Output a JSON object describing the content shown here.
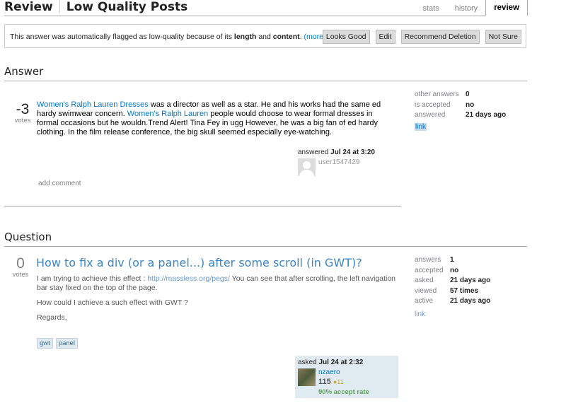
{
  "header": {
    "title": "Review",
    "subtitle": "Low Quality Posts",
    "tabs": [
      "stats",
      "history",
      "review"
    ]
  },
  "notice": {
    "text_pre": "This answer was automatically flagged as low-quality because of its ",
    "bold1": "length",
    "text_mid": " and ",
    "bold2": "content",
    "text_post": ". ",
    "more": "(more)",
    "buttons": [
      "Looks Good",
      "Edit",
      "Recommend Deletion",
      "Not Sure"
    ]
  },
  "answer": {
    "section_title": "Answer",
    "votes": "-3",
    "votes_label": "votes",
    "link1": "Women's Ralph Lauren Dresses",
    "text1": " was a director as well as a star. He and his works had the same ed hardy swimwear concern. ",
    "link2": "Women's Ralph Lauren",
    "text2": " people would choose to wear formal dresses in formal occasions but he wouldn.Trend Alert! Tina Fey in ugg However, he was a big fan of ed hardy clothing. In the film release conference, the big skull seemed especially eye-watching.",
    "answered_label": "answered ",
    "answered_date": "Jul 24 at 3:20",
    "user": "user1547429",
    "add_comment": "add comment",
    "stats": {
      "other_answers_label": "other answers",
      "other_answers": "0",
      "is_accepted_label": "is accepted",
      "is_accepted": "no",
      "answered_label": "answered",
      "answered": "21 days ago",
      "link": "link"
    }
  },
  "question": {
    "section_title": "Question",
    "votes": "0",
    "votes_label": "votes",
    "title": "How to fix a div (or a panel...) after some scroll (in GWT)?",
    "body1_pre": "I am trying to achieve this effect : ",
    "body1_link": "http://massless.org/pegs/",
    "body1_post": " You can see that after scrolling, the left navigation bar stay fixed on the top of the page.",
    "body2": "How could I achieve a such effect with GWT ?",
    "body3": "Regards,",
    "tags": [
      "gwt",
      "panel"
    ],
    "asked_label": "asked ",
    "asked_date": "Jul 24 at 2:32",
    "owner": "nzaero",
    "rep": "115",
    "badge": "●11",
    "accept_rate": "90% accept rate",
    "stats": {
      "answers_label": "answers",
      "answers": "1",
      "accepted_label": "accepted",
      "accepted": "no",
      "asked_label": "asked",
      "asked": "21 days ago",
      "viewed_label": "viewed",
      "viewed": "57 times",
      "active_label": "active",
      "active": "21 days ago",
      "link": "link"
    }
  }
}
